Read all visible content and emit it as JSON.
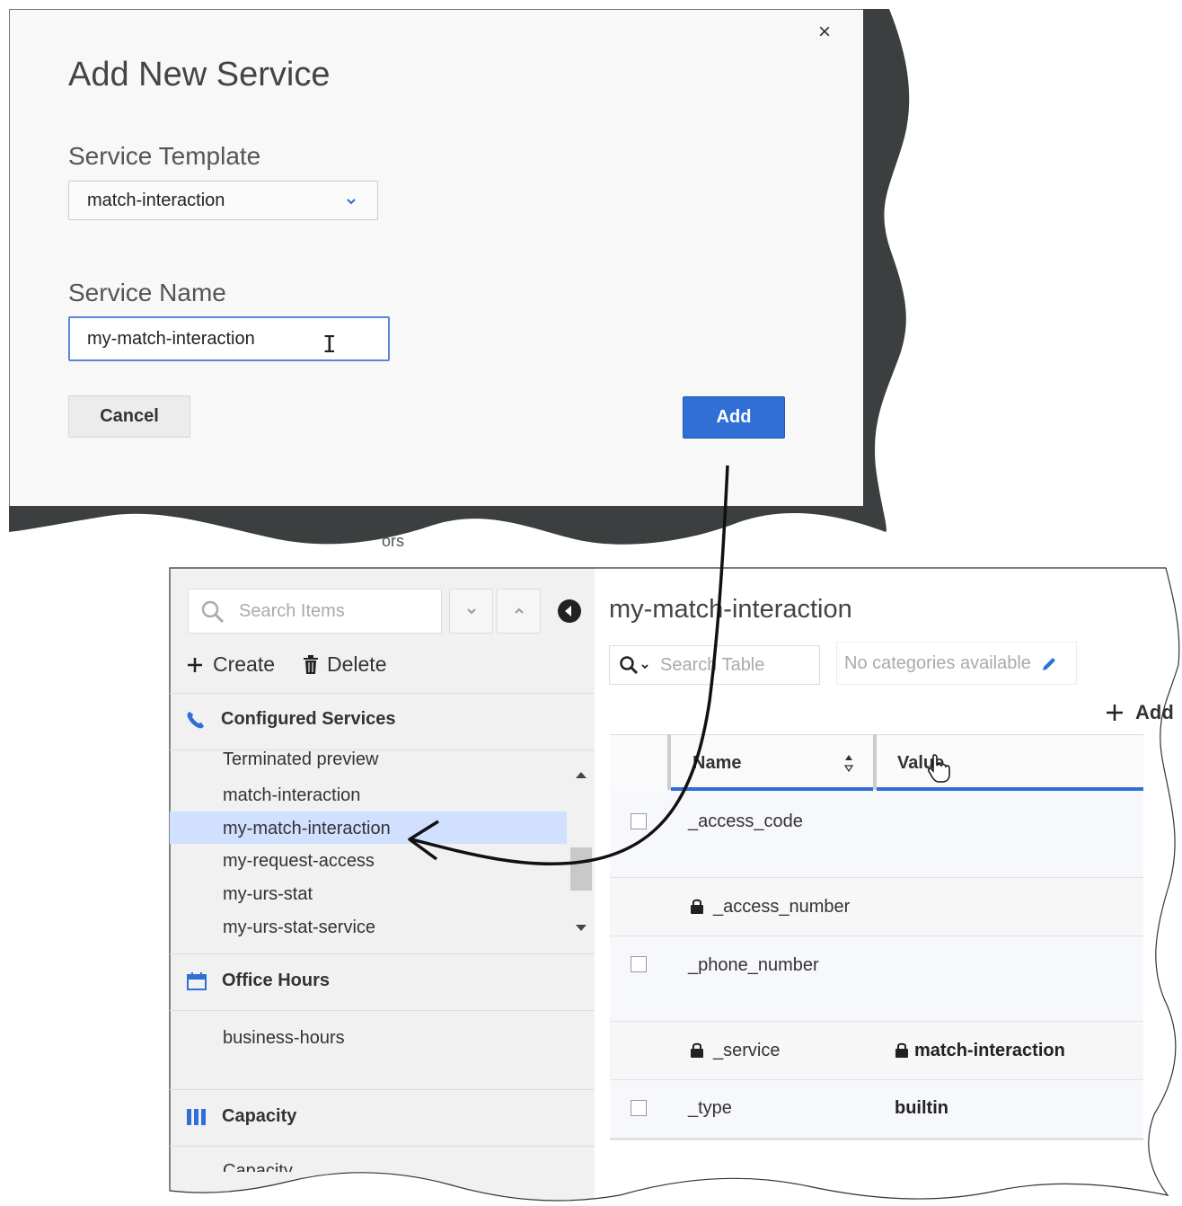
{
  "dialog": {
    "title": "Add New Service",
    "template_label": "Service Template",
    "template_value": "match-interaction",
    "name_label": "Service Name",
    "name_value": "my-match-interaction",
    "cancel_label": "Cancel",
    "add_label": "Add",
    "close_glyph": "×",
    "close_icon": "close-icon",
    "background_fragment": "ors"
  },
  "sidebar": {
    "search_placeholder": "Search Items",
    "create_label": "Create",
    "delete_label": "Delete",
    "sections": [
      {
        "title": "Configured Services",
        "icon": "phone-icon",
        "items": [
          "Terminated preview",
          "match-interaction",
          "my-match-interaction",
          "my-request-access",
          "my-urs-stat",
          "my-urs-stat-service"
        ],
        "selected": "my-match-interaction"
      },
      {
        "title": "Office Hours",
        "icon": "calendar-icon",
        "items": [
          "business-hours"
        ]
      },
      {
        "title": "Capacity",
        "icon": "columns-icon",
        "items": [
          "Capacity"
        ]
      }
    ]
  },
  "detail": {
    "title": "my-match-interaction",
    "search_placeholder": "Search Table",
    "categories_placeholder": "No categories available",
    "add_label": "Add",
    "columns": [
      "Name",
      "Value"
    ],
    "rows": [
      {
        "name": "_access_code",
        "value": "",
        "locked": false,
        "checkbox": true
      },
      {
        "name": "_access_number",
        "value": "",
        "locked": true,
        "checkbox": false
      },
      {
        "name": "_phone_number",
        "value": "",
        "locked": false,
        "checkbox": true
      },
      {
        "name": "_service",
        "value": "match-interaction",
        "locked": true,
        "checkbox": false,
        "value_locked": true
      },
      {
        "name": "_type",
        "value": "builtin",
        "locked": false,
        "checkbox": true
      }
    ]
  },
  "colors": {
    "accent": "#2f6fd6",
    "selected_row": "#d2e0ff",
    "backdrop": "#3c3f3f"
  }
}
